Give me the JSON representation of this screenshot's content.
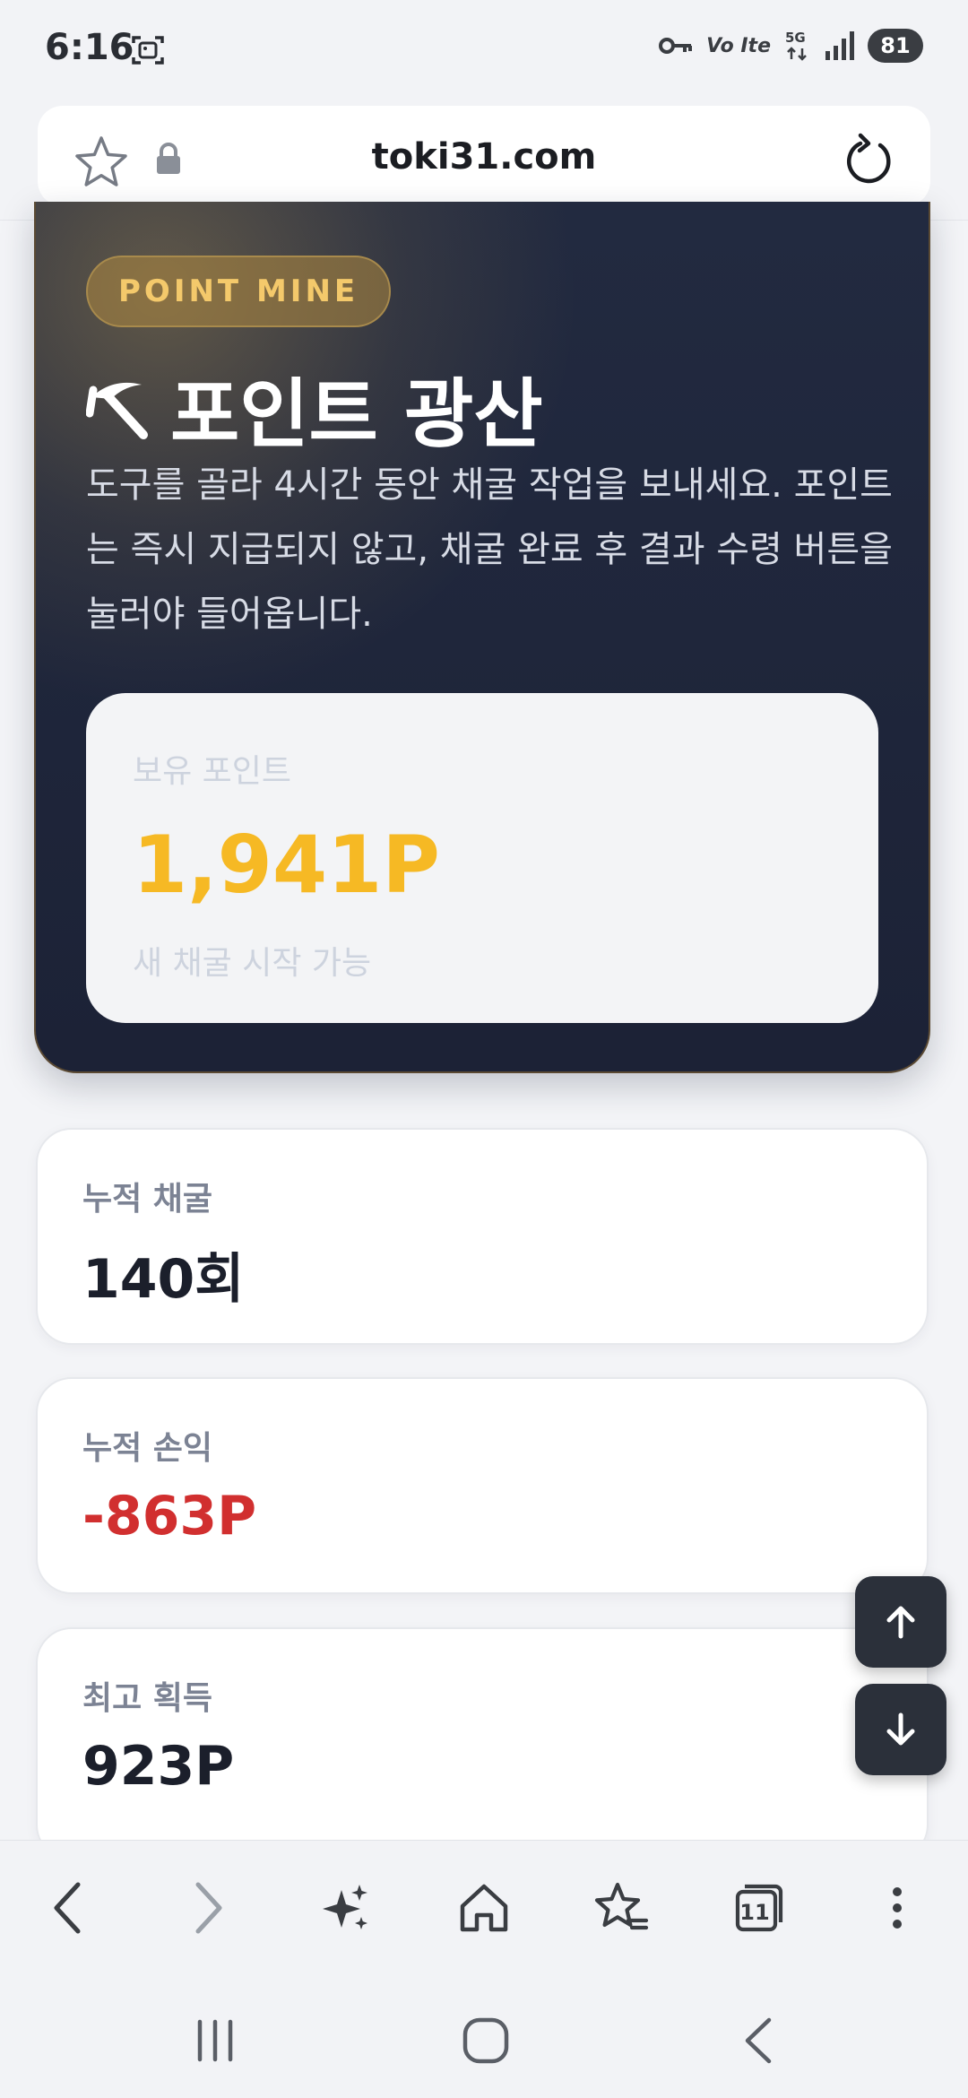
{
  "status_bar": {
    "time": "6:16",
    "network": "5G",
    "volte": "Vo Ite",
    "battery": "81"
  },
  "browser": {
    "url": "toki31.com"
  },
  "hero": {
    "badge": "POINT MINE",
    "title": "포인트 광산",
    "description": "도구를 골라 4시간 동안 채굴 작업을 보내세요. 포인트는 즉시 지급되지 않고, 채굴 완료 후 결과 수령 버튼을 눌러야 들어옵니다.",
    "points_label": "보유 포인트",
    "points_value": "1,941P",
    "points_status": "새 채굴 시작 가능"
  },
  "stats": [
    {
      "label": "누적 채굴",
      "value": "140회"
    },
    {
      "label": "누적 손익",
      "value": "-863P"
    },
    {
      "label": "최고 획득",
      "value": "923P"
    }
  ],
  "toolbar": {
    "tabs_count": "11"
  },
  "colors": {
    "accent_gold": "#f6b924",
    "negative": "#d12f2f",
    "hero_bg": "#1c2236"
  }
}
